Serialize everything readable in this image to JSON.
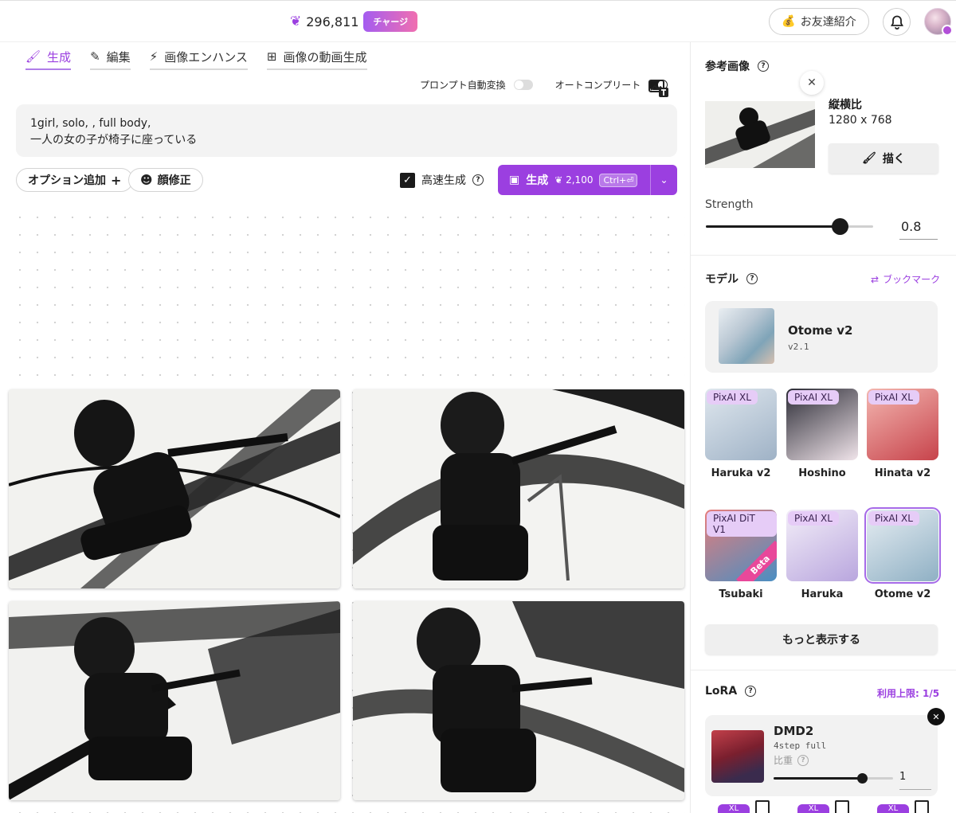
{
  "header": {
    "credits": "296,811",
    "charge_label": "チャージ",
    "friend_label": "お友達紹介"
  },
  "tabs": [
    {
      "label": "生成",
      "active": true
    },
    {
      "label": "編集",
      "active": false
    },
    {
      "label": "画像エンハンス",
      "active": false
    },
    {
      "label": "画像の動画生成",
      "active": false
    }
  ],
  "toggles": {
    "prompt_convert_label": "プロンプト自動変換",
    "prompt_convert_on": false,
    "autocomplete_label": "オートコンプリート",
    "autocomplete_on": true
  },
  "prompt": {
    "line1": "1girl, solo, , full body,",
    "line2": "一人の女の子が椅子に座っている"
  },
  "options": {
    "add_option_label": "オプション追加",
    "face_fix_label": "顔修正",
    "high_speed_label": "高速生成",
    "high_speed_checked": true
  },
  "generate": {
    "label": "生成",
    "cost": "2,100",
    "shortcut": "Ctrl+⏎"
  },
  "right_panel": {
    "reference": {
      "title": "参考画像",
      "aspect_label": "縦横比",
      "aspect_value": "1280 x 768",
      "draw_label": "描く",
      "strength_label": "Strength",
      "strength_value": "0.8",
      "strength_fraction": 0.8
    },
    "model": {
      "title": "モデル",
      "bookmark_label": "ブックマーク",
      "selected_name": "Otome v2",
      "selected_version": "v2.1",
      "tiles": [
        {
          "tag": "PixAI XL",
          "name": "Haruka v2",
          "colors": [
            "#dfe7ee",
            "#9fb2c6"
          ]
        },
        {
          "tag": "PixAI XL",
          "name": "Hoshino",
          "colors": [
            "#2b2b35",
            "#f0e4ea"
          ]
        },
        {
          "tag": "PixAI XL",
          "name": "Hinata v2",
          "colors": [
            "#f3b6b0",
            "#c7434b"
          ]
        },
        {
          "tag": "PixAI DiT V1",
          "name": "Tsubaki",
          "colors": [
            "#e77d7a",
            "#4a8ec2"
          ],
          "beta": "Beta"
        },
        {
          "tag": "PixAI XL",
          "name": "Haruka",
          "colors": [
            "#f3eef8",
            "#b9a6de"
          ]
        },
        {
          "tag": "PixAI XL",
          "name": "Otome v2",
          "colors": [
            "#e6edf2",
            "#8fb0c4"
          ],
          "selected": true
        }
      ],
      "more_label": "もっと表示する"
    },
    "lora": {
      "title": "LoRA",
      "limit_label": "利用上限: 1/5",
      "name": "DMD2",
      "sub": "4step full",
      "weight_label": "比重",
      "weight_value": "1",
      "weight_fraction": 0.74,
      "bottom_tags": [
        "XL",
        "XL",
        "XL"
      ]
    }
  }
}
